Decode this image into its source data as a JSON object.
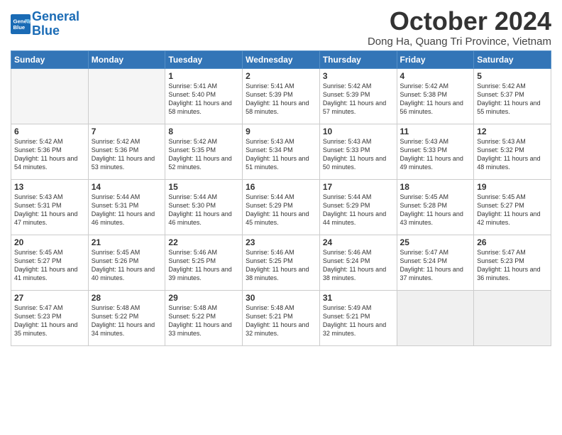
{
  "header": {
    "logo_line1": "General",
    "logo_line2": "Blue",
    "month_title": "October 2024",
    "subtitle": "Dong Ha, Quang Tri Province, Vietnam"
  },
  "days_of_week": [
    "Sunday",
    "Monday",
    "Tuesday",
    "Wednesday",
    "Thursday",
    "Friday",
    "Saturday"
  ],
  "weeks": [
    [
      {
        "day": "",
        "empty": true
      },
      {
        "day": "",
        "empty": true
      },
      {
        "day": "1",
        "rise": "5:41 AM",
        "set": "5:40 PM",
        "daylight": "11 hours and 58 minutes."
      },
      {
        "day": "2",
        "rise": "5:41 AM",
        "set": "5:39 PM",
        "daylight": "11 hours and 58 minutes."
      },
      {
        "day": "3",
        "rise": "5:42 AM",
        "set": "5:39 PM",
        "daylight": "11 hours and 57 minutes."
      },
      {
        "day": "4",
        "rise": "5:42 AM",
        "set": "5:38 PM",
        "daylight": "11 hours and 56 minutes."
      },
      {
        "day": "5",
        "rise": "5:42 AM",
        "set": "5:37 PM",
        "daylight": "11 hours and 55 minutes."
      }
    ],
    [
      {
        "day": "6",
        "rise": "5:42 AM",
        "set": "5:36 PM",
        "daylight": "11 hours and 54 minutes."
      },
      {
        "day": "7",
        "rise": "5:42 AM",
        "set": "5:36 PM",
        "daylight": "11 hours and 53 minutes."
      },
      {
        "day": "8",
        "rise": "5:42 AM",
        "set": "5:35 PM",
        "daylight": "11 hours and 52 minutes."
      },
      {
        "day": "9",
        "rise": "5:43 AM",
        "set": "5:34 PM",
        "daylight": "11 hours and 51 minutes."
      },
      {
        "day": "10",
        "rise": "5:43 AM",
        "set": "5:33 PM",
        "daylight": "11 hours and 50 minutes."
      },
      {
        "day": "11",
        "rise": "5:43 AM",
        "set": "5:33 PM",
        "daylight": "11 hours and 49 minutes."
      },
      {
        "day": "12",
        "rise": "5:43 AM",
        "set": "5:32 PM",
        "daylight": "11 hours and 48 minutes."
      }
    ],
    [
      {
        "day": "13",
        "rise": "5:43 AM",
        "set": "5:31 PM",
        "daylight": "11 hours and 47 minutes."
      },
      {
        "day": "14",
        "rise": "5:44 AM",
        "set": "5:31 PM",
        "daylight": "11 hours and 46 minutes."
      },
      {
        "day": "15",
        "rise": "5:44 AM",
        "set": "5:30 PM",
        "daylight": "11 hours and 46 minutes."
      },
      {
        "day": "16",
        "rise": "5:44 AM",
        "set": "5:29 PM",
        "daylight": "11 hours and 45 minutes."
      },
      {
        "day": "17",
        "rise": "5:44 AM",
        "set": "5:29 PM",
        "daylight": "11 hours and 44 minutes."
      },
      {
        "day": "18",
        "rise": "5:45 AM",
        "set": "5:28 PM",
        "daylight": "11 hours and 43 minutes."
      },
      {
        "day": "19",
        "rise": "5:45 AM",
        "set": "5:27 PM",
        "daylight": "11 hours and 42 minutes."
      }
    ],
    [
      {
        "day": "20",
        "rise": "5:45 AM",
        "set": "5:27 PM",
        "daylight": "11 hours and 41 minutes."
      },
      {
        "day": "21",
        "rise": "5:45 AM",
        "set": "5:26 PM",
        "daylight": "11 hours and 40 minutes."
      },
      {
        "day": "22",
        "rise": "5:46 AM",
        "set": "5:25 PM",
        "daylight": "11 hours and 39 minutes."
      },
      {
        "day": "23",
        "rise": "5:46 AM",
        "set": "5:25 PM",
        "daylight": "11 hours and 38 minutes."
      },
      {
        "day": "24",
        "rise": "5:46 AM",
        "set": "5:24 PM",
        "daylight": "11 hours and 38 minutes."
      },
      {
        "day": "25",
        "rise": "5:47 AM",
        "set": "5:24 PM",
        "daylight": "11 hours and 37 minutes."
      },
      {
        "day": "26",
        "rise": "5:47 AM",
        "set": "5:23 PM",
        "daylight": "11 hours and 36 minutes."
      }
    ],
    [
      {
        "day": "27",
        "rise": "5:47 AM",
        "set": "5:23 PM",
        "daylight": "11 hours and 35 minutes."
      },
      {
        "day": "28",
        "rise": "5:48 AM",
        "set": "5:22 PM",
        "daylight": "11 hours and 34 minutes."
      },
      {
        "day": "29",
        "rise": "5:48 AM",
        "set": "5:22 PM",
        "daylight": "11 hours and 33 minutes."
      },
      {
        "day": "30",
        "rise": "5:48 AM",
        "set": "5:21 PM",
        "daylight": "11 hours and 32 minutes."
      },
      {
        "day": "31",
        "rise": "5:49 AM",
        "set": "5:21 PM",
        "daylight": "11 hours and 32 minutes."
      },
      {
        "day": "",
        "empty": true
      },
      {
        "day": "",
        "empty": true
      }
    ]
  ],
  "cell_labels": {
    "sunrise": "Sunrise:",
    "sunset": "Sunset:",
    "daylight": "Daylight:"
  }
}
